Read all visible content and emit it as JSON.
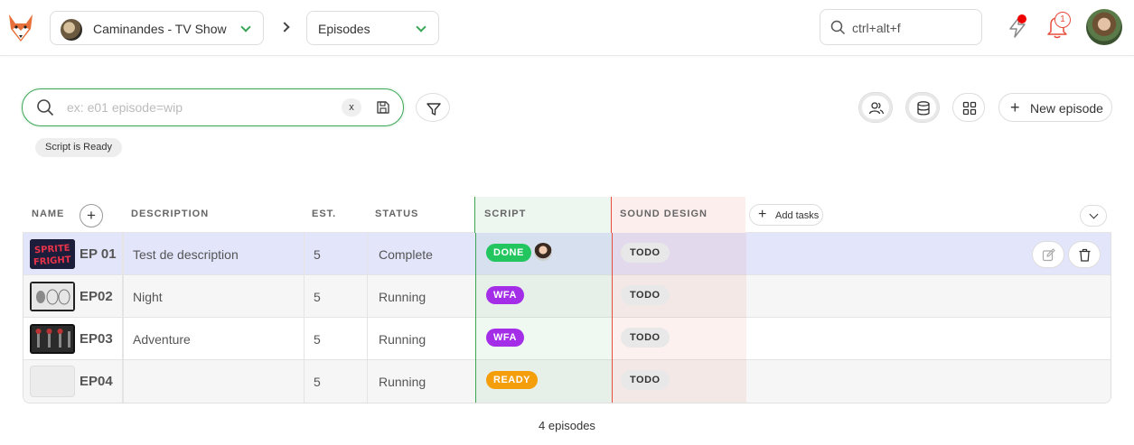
{
  "topbar": {
    "production": "Caminandes - TV Show",
    "section": "Episodes",
    "search_placeholder": "ctrl+alt+f",
    "notifications_count": "1"
  },
  "filters": {
    "search_placeholder": "ex: e01 episode=wip",
    "clear_label": "x",
    "new_episode_label": "New episode",
    "active_filter": "Script is Ready"
  },
  "table": {
    "headers": {
      "name": "NAME",
      "description": "DESCRIPTION",
      "est": "EST.",
      "status": "STATUS",
      "script": "SCRIPT",
      "sound": "SOUND DESIGN",
      "add_tasks": "Add tasks"
    },
    "rows": [
      {
        "name": "EP 01",
        "description": "Test de description",
        "est": "5",
        "status": "Complete",
        "script": "DONE",
        "script_color": "#22c55e",
        "sound": "TODO"
      },
      {
        "name": "EP02",
        "description": "Night",
        "est": "5",
        "status": "Running",
        "script": "WFA",
        "script_color": "#a42ee8",
        "sound": "TODO"
      },
      {
        "name": "EP03",
        "description": "Adventure",
        "est": "5",
        "status": "Running",
        "script": "WFA",
        "script_color": "#a42ee8",
        "sound": "TODO"
      },
      {
        "name": "EP04",
        "description": "",
        "est": "5",
        "status": "Running",
        "script": "READY",
        "script_color": "#f59e0b",
        "sound": "TODO"
      }
    ]
  },
  "footer": {
    "count": "4 episodes"
  },
  "icons": [
    "fox-logo-icon",
    "chevron-down-icon",
    "chevron-right-icon",
    "search-icon",
    "bolt-icon",
    "bell-icon",
    "save-icon",
    "filter-icon",
    "people-icon",
    "database-icon",
    "grid-icon",
    "plus-icon",
    "edit-icon",
    "trash-icon"
  ]
}
